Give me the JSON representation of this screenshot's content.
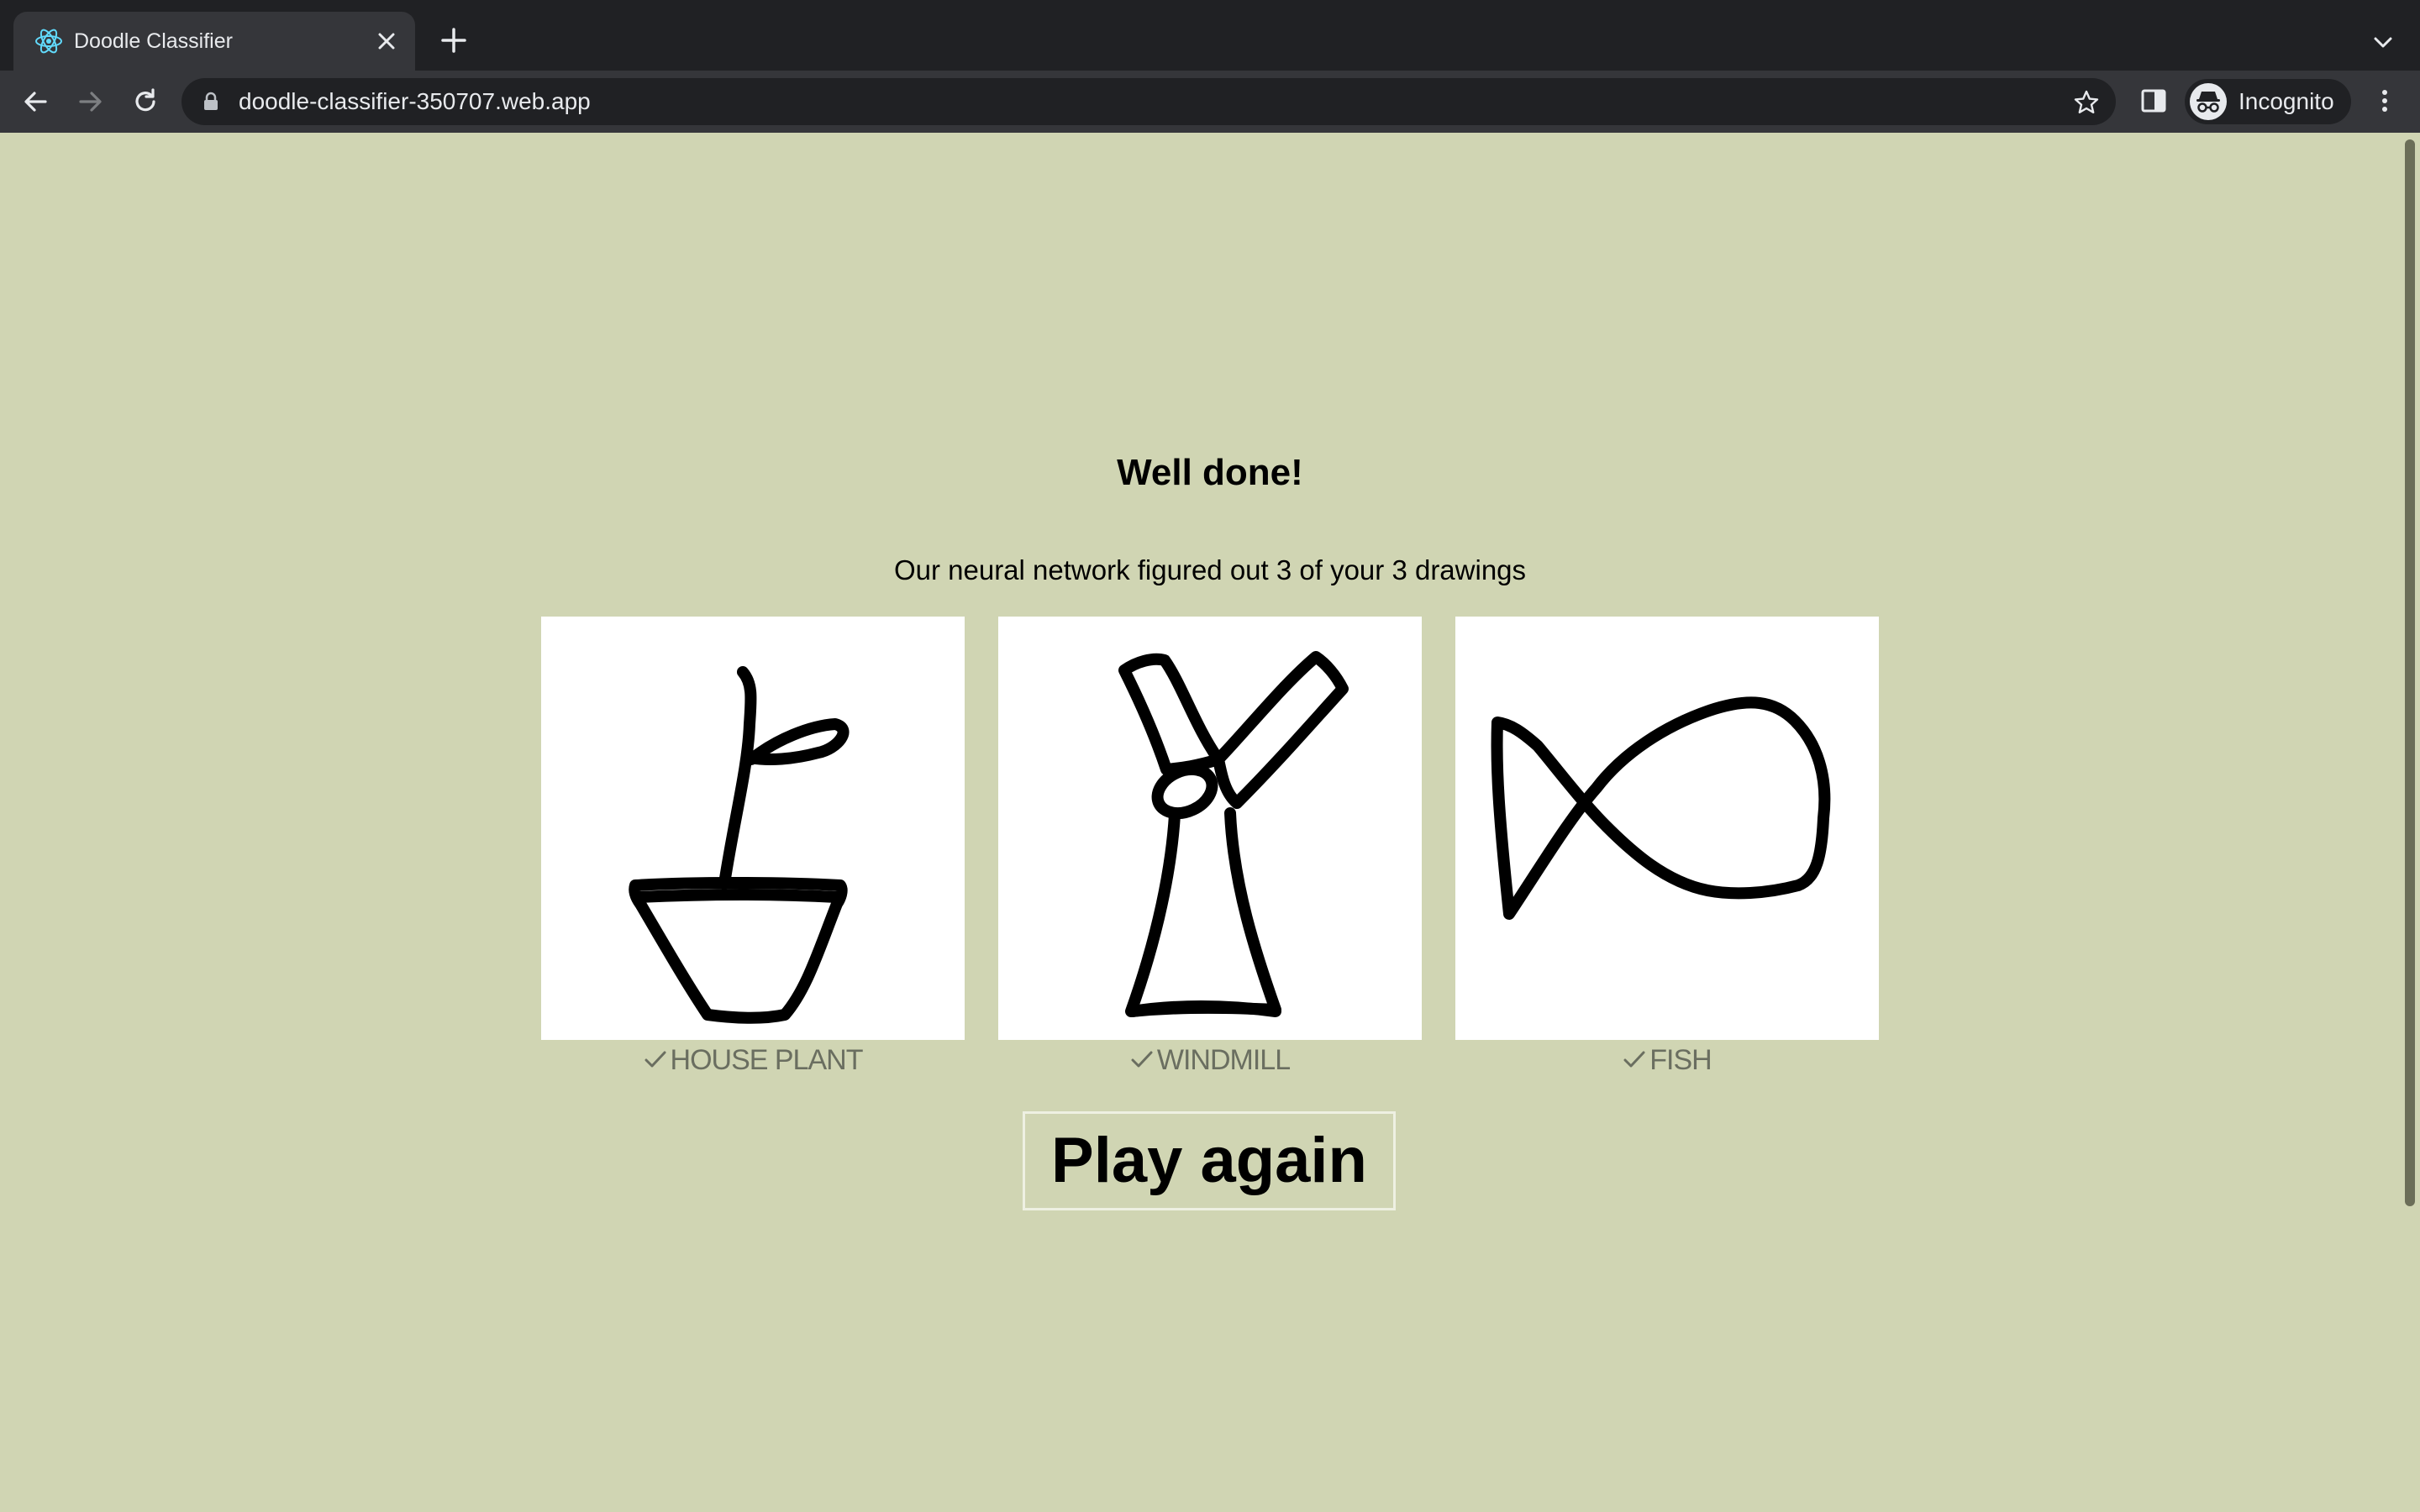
{
  "browser": {
    "tab_title": "Doodle Classifier",
    "url": "doodle-classifier-350707.web.app",
    "profile_label": "Incognito"
  },
  "page": {
    "heading": "Well done!",
    "subtitle": "Our neural network figured out 3 of your 3 drawings",
    "results": [
      {
        "label": "HOUSE PLANT",
        "correct": true,
        "icon": "check-icon"
      },
      {
        "label": "WINDMILL",
        "correct": true,
        "icon": "check-icon"
      },
      {
        "label": "FISH",
        "correct": true,
        "icon": "check-icon"
      }
    ],
    "play_again_label": "Play again"
  },
  "colors": {
    "page_background": "#d0d5b3",
    "result_text": "#6a6e60",
    "chrome_dark": "#202124",
    "chrome_toolbar": "#35363a"
  }
}
